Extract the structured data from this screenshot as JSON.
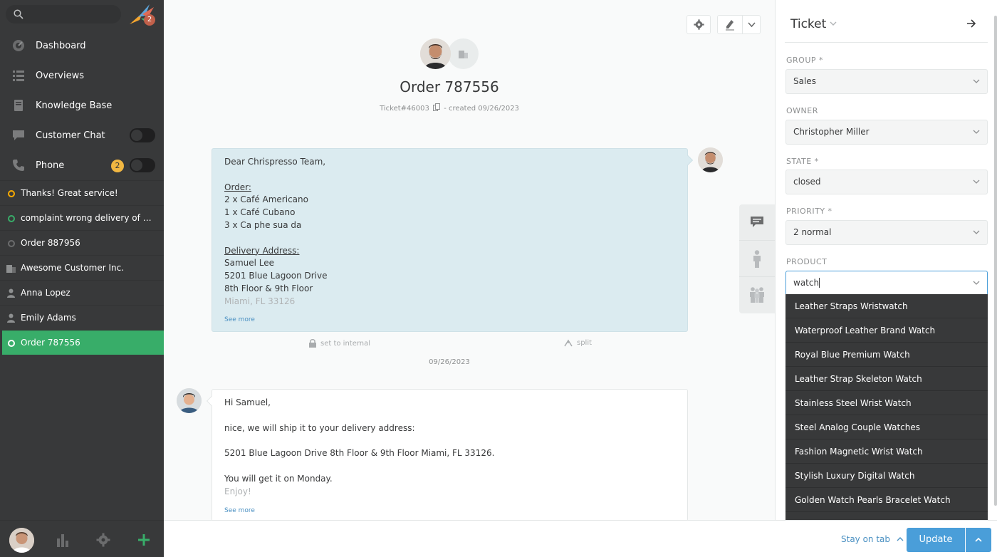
{
  "sidebar": {
    "logo_badge": "2",
    "nav": [
      {
        "label": "Dashboard",
        "icon": "dashboard-icon"
      },
      {
        "label": "Overviews",
        "icon": "list-icon"
      },
      {
        "label": "Knowledge Base",
        "icon": "book-icon"
      },
      {
        "label": "Customer Chat",
        "icon": "chat-icon"
      },
      {
        "label": "Phone",
        "icon": "phone-icon",
        "badge": "2"
      }
    ],
    "tabs": [
      {
        "label": "Thanks! Great service!"
      },
      {
        "label": "complaint wrong delivery of order"
      },
      {
        "label": "Order 887956"
      },
      {
        "label": "Awesome Customer Inc."
      },
      {
        "label": "Anna Lopez"
      },
      {
        "label": "Emily Adams"
      },
      {
        "label": "Order 787556"
      }
    ]
  },
  "ticket": {
    "title": "Order 787556",
    "number": "Ticket#46003",
    "created": "- created 09/26/2023"
  },
  "articles": {
    "customer": {
      "lines": [
        "Dear Chrispresso Team,",
        "",
        "Order:",
        "2 x Café Americano",
        "1 x Café Cubano",
        "3 x Ca phe sua da",
        "",
        "Delivery Address:",
        "Samuel Lee",
        "5201 Blue Lagoon Drive",
        "8th Floor & 9th Floor",
        "Miami, FL 33126"
      ],
      "see_more": "See more",
      "set_internal": "set to internal",
      "split": "split"
    },
    "date": "09/26/2023",
    "agent": {
      "lines": [
        "Hi Samuel,",
        "",
        "nice, we will ship it to your delivery address:",
        "",
        "5201 Blue Lagoon Drive 8th Floor & 9th Floor Miami, FL 33126.",
        "",
        "You will get it on Monday.",
        "Enjoy!"
      ],
      "see_more": "See more"
    }
  },
  "panel": {
    "title": "Ticket",
    "fields": {
      "group": {
        "label": "GROUP *",
        "value": "Sales"
      },
      "owner": {
        "label": "OWNER",
        "value": "Christopher Miller"
      },
      "state": {
        "label": "STATE *",
        "value": "closed"
      },
      "priority": {
        "label": "PRIORITY *",
        "value": "2 normal"
      },
      "product": {
        "label": "PRODUCT",
        "value": "watch"
      }
    },
    "product_options": [
      "Leather Straps Wristwatch",
      "Waterproof Leather Brand Watch",
      "Royal Blue Premium Watch",
      "Leather Strap Skeleton Watch",
      "Stainless Steel Wrist Watch",
      "Steel Analog Couple Watches",
      "Fashion Magnetic Wrist Watch",
      "Stylish Luxury Digital Watch",
      "Golden Watch Pearls Bracelet Watch"
    ]
  },
  "bottom": {
    "stay_on_tab": "Stay on tab",
    "update": "Update"
  },
  "colors": {
    "sidebar": "#38393a",
    "active_tab": "#38ad69",
    "accent": "#4a9ed9",
    "customer_bubble": "#dbebf0"
  }
}
